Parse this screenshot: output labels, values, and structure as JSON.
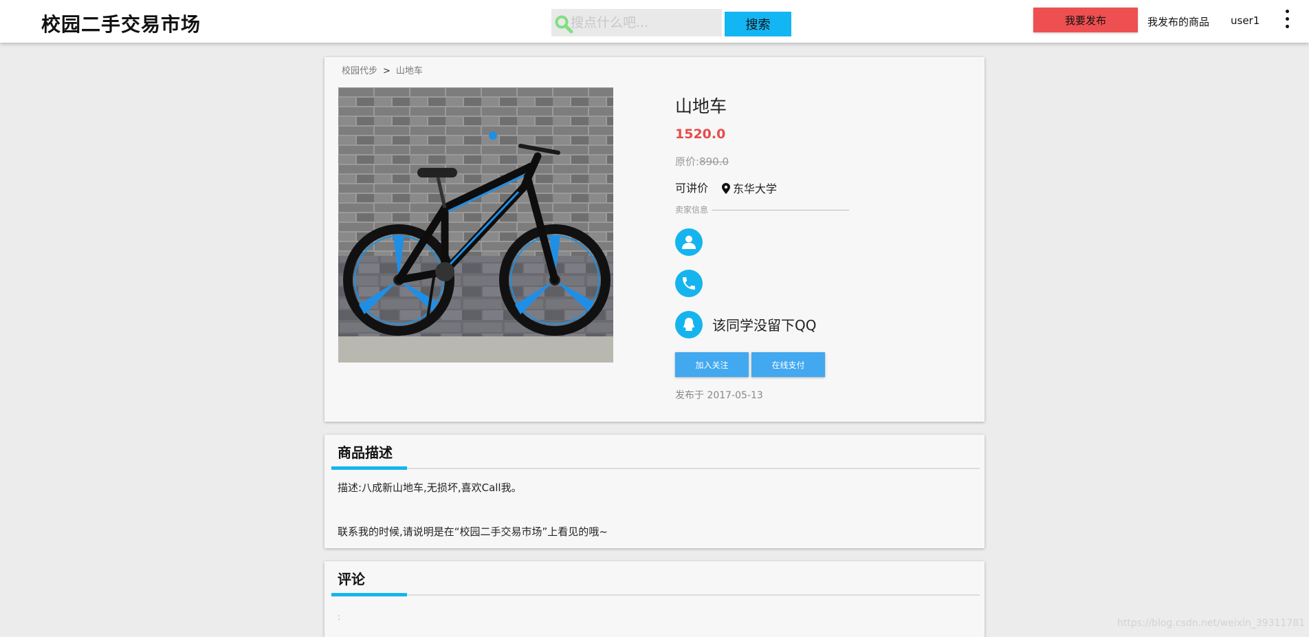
{
  "header": {
    "logo": "校园二手交易市场",
    "search_placeholder": "搜点什么吧...",
    "search_button": "搜索",
    "publish_button": "我要发布",
    "my_goods": "我发布的商品",
    "username": "user1"
  },
  "breadcrumb": {
    "category": "校园代步",
    "separator": ">",
    "item": "山地车"
  },
  "product": {
    "title": "山地车",
    "price": "1520.0",
    "original_label": "原价:",
    "original_price": "890.0",
    "negotiable": "可讲价",
    "location": "东华大学",
    "seller_label": "卖家信息",
    "qq_text": "该同学没留下QQ",
    "follow_button": "加入关注",
    "pay_button": "在线支付",
    "publish_date": "发布于 2017-05-13"
  },
  "description": {
    "title": "商品描述",
    "text": "描述:八成新山地车,无损坏,喜欢Call我。",
    "contact_note": "联系我的时候,请说明是在“校园二手交易市场”上看见的哦~"
  },
  "comments": {
    "title": "评论",
    "stub": ":"
  },
  "watermark": "https://blog.csdn.net/weixin_39311781",
  "colors": {
    "accent": "#16b4ee",
    "price": "#e84a4a",
    "publish": "#ee4f50",
    "action": "#42a8f0"
  },
  "icons": [
    "search-icon",
    "more-vert-icon",
    "location-pin-icon",
    "person-icon",
    "phone-icon",
    "qq-icon"
  ]
}
